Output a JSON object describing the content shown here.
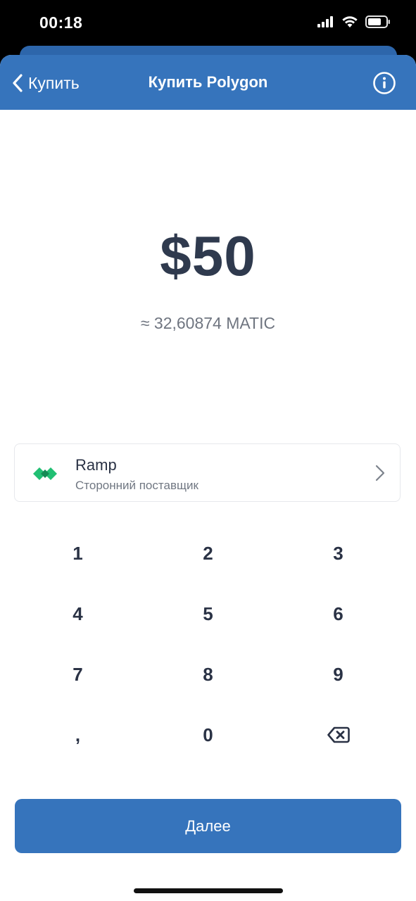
{
  "status_bar": {
    "time": "00:18"
  },
  "nav": {
    "back_label": "Купить",
    "title": "Купить Polygon"
  },
  "amount": {
    "fiat": "$50",
    "crypto": "≈ 32,60874 MATIC"
  },
  "provider": {
    "name": "Ramp",
    "subtitle": "Сторонний поставщик"
  },
  "keypad": {
    "keys": [
      "1",
      "2",
      "3",
      "4",
      "5",
      "6",
      "7",
      "8",
      "9",
      ",",
      "0"
    ],
    "backspace_icon": "backspace-icon"
  },
  "next_button": {
    "label": "Далее"
  },
  "colors": {
    "accent": "#3674bc",
    "text_dark": "#2f3a4e",
    "ramp_green": "#21bf73"
  }
}
